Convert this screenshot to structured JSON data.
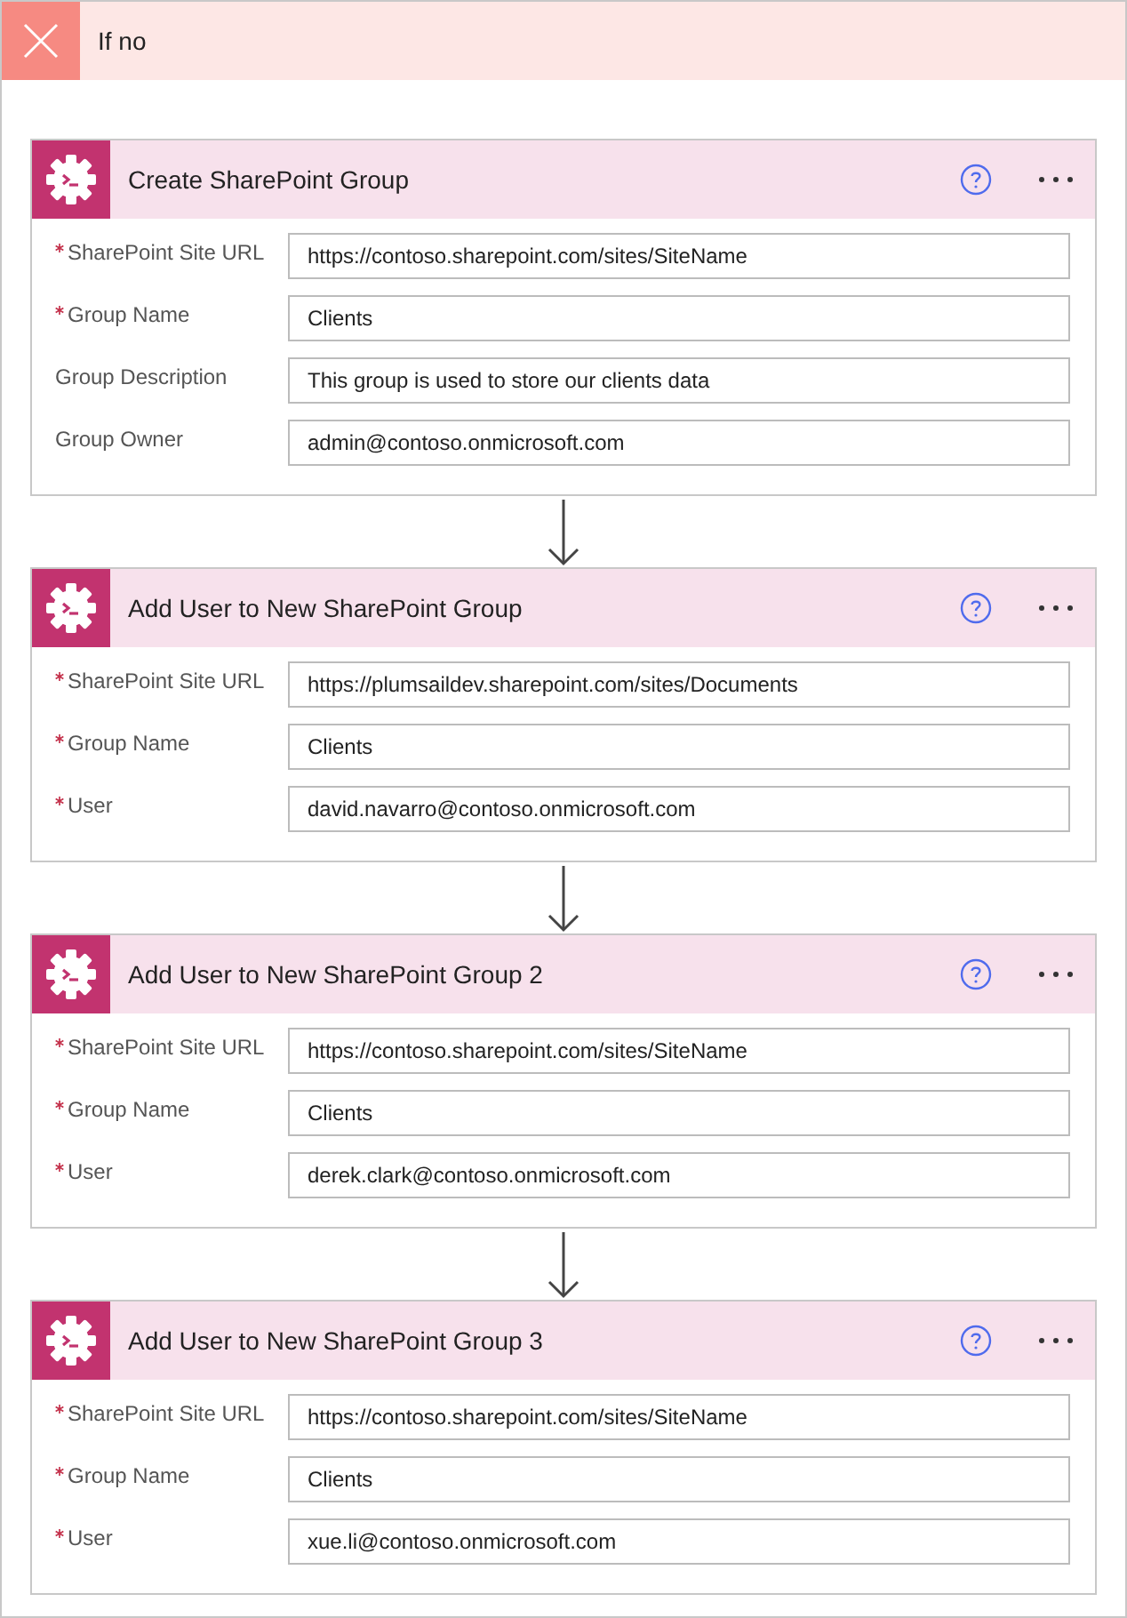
{
  "branch": {
    "title": "If no"
  },
  "actions": [
    {
      "title": "Create SharePoint Group",
      "fields": [
        {
          "label": "SharePoint Site URL",
          "required": true,
          "value": "https://contoso.sharepoint.com/sites/SiteName"
        },
        {
          "label": "Group Name",
          "required": true,
          "value": "Clients"
        },
        {
          "label": "Group Description",
          "required": false,
          "value": "This group is used to store our clients data"
        },
        {
          "label": "Group Owner",
          "required": false,
          "value": "admin@contoso.onmicrosoft.com"
        }
      ]
    },
    {
      "title": "Add User to New SharePoint Group",
      "fields": [
        {
          "label": "SharePoint Site URL",
          "required": true,
          "value": "https://plumsaildev.sharepoint.com/sites/Documents"
        },
        {
          "label": "Group Name",
          "required": true,
          "value": "Clients"
        },
        {
          "label": "User",
          "required": true,
          "value": "david.navarro@contoso.onmicrosoft.com"
        }
      ]
    },
    {
      "title": "Add User to New SharePoint Group 2",
      "fields": [
        {
          "label": "SharePoint Site URL",
          "required": true,
          "value": "https://contoso.sharepoint.com/sites/SiteName"
        },
        {
          "label": "Group Name",
          "required": true,
          "value": "Clients"
        },
        {
          "label": "User",
          "required": true,
          "value": "derek.clark@contoso.onmicrosoft.com"
        }
      ]
    },
    {
      "title": "Add User to New SharePoint Group 3",
      "fields": [
        {
          "label": "SharePoint Site URL",
          "required": true,
          "value": "https://contoso.sharepoint.com/sites/SiteName"
        },
        {
          "label": "Group Name",
          "required": true,
          "value": "Clients"
        },
        {
          "label": "User",
          "required": true,
          "value": "xue.li@contoso.onmicrosoft.com"
        }
      ]
    }
  ]
}
